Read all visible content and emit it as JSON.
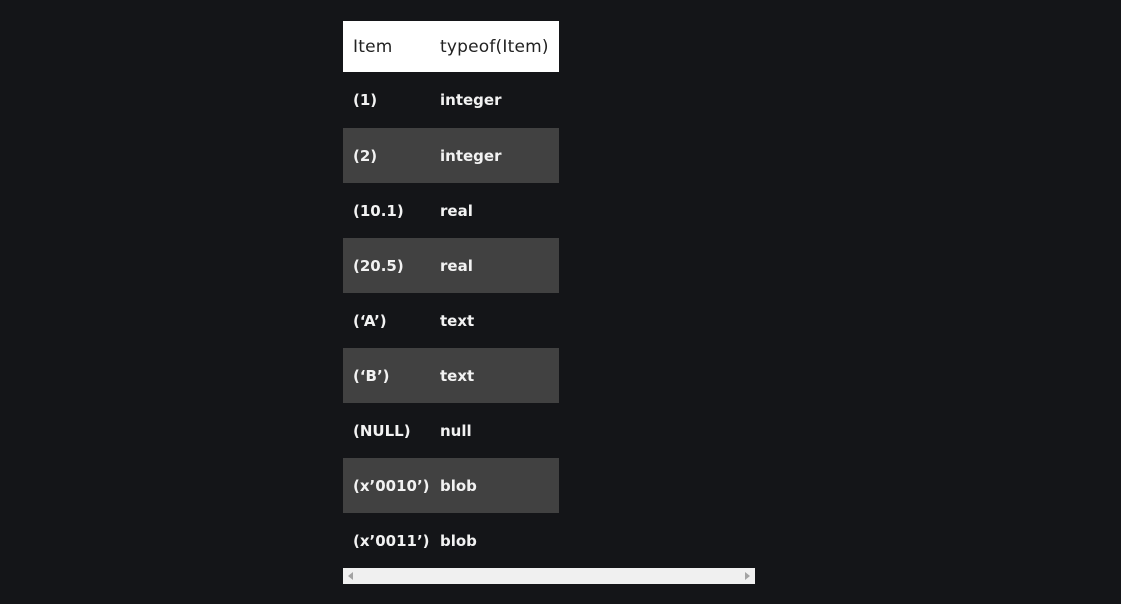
{
  "table": {
    "headers": [
      "Item",
      "typeof(Item)"
    ],
    "rows": [
      {
        "item": "(1)",
        "type": "integer"
      },
      {
        "item": "(2)",
        "type": "integer"
      },
      {
        "item": "(10.1)",
        "type": "real"
      },
      {
        "item": "(20.5)",
        "type": "real"
      },
      {
        "item": "(‘A’)",
        "type": "text"
      },
      {
        "item": "(‘B’)",
        "type": "text"
      },
      {
        "item": "(NULL)",
        "type": "null"
      },
      {
        "item": "(x’0010’)",
        "type": "blob"
      },
      {
        "item": "(x’0011’)",
        "type": "blob"
      }
    ]
  },
  "scrollbar": {
    "left_icon": "arrow-left-icon",
    "right_icon": "arrow-right-icon"
  }
}
